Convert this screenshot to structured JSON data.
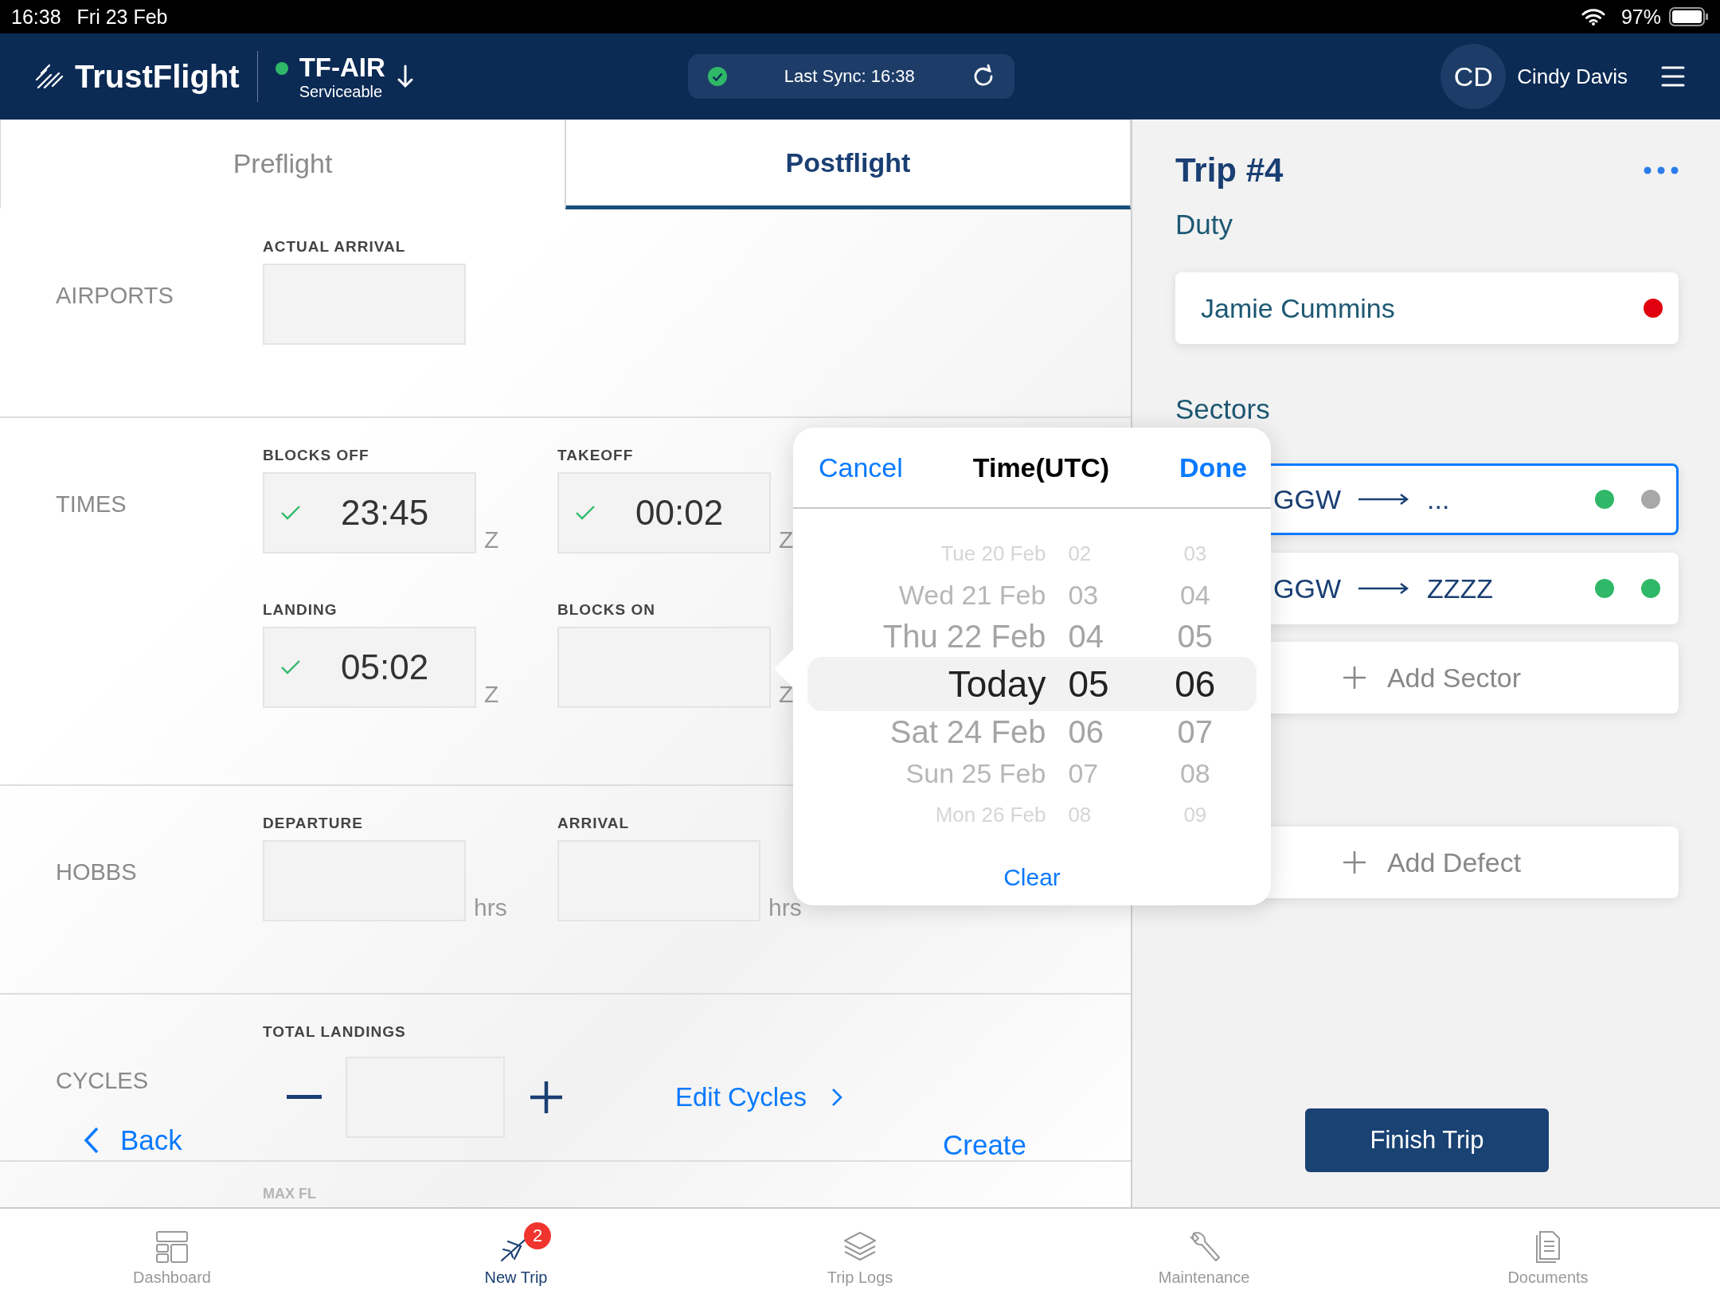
{
  "status_bar": {
    "time": "16:38",
    "date": "Fri 23 Feb",
    "battery": "97%"
  },
  "header": {
    "brand": "TrustFlight",
    "aircraft": "TF-AIR",
    "aircraft_status": "Serviceable",
    "sync": "Last Sync: 16:38",
    "avatar": "CD",
    "user": "Cindy Davis"
  },
  "tabs": [
    {
      "label": "Preflight",
      "selected": false
    },
    {
      "label": "Postflight",
      "selected": true
    }
  ],
  "sections": [
    {
      "title": "AIRPORTS",
      "rows": [
        [
          {
            "label": "ACTUAL ARRIVAL",
            "checked": false
          }
        ]
      ]
    },
    {
      "title": "TIMES",
      "rows": [
        [
          {
            "label": "BLOCKS OFF",
            "value": "23:45",
            "checked": true,
            "unit": "Z"
          },
          {
            "label": "TAKEOFF",
            "value": "00:02",
            "checked": true,
            "unit": "Z"
          }
        ],
        [
          {
            "label": "LANDING",
            "value": "05:02",
            "checked": true,
            "unit": "Z"
          },
          {
            "label": "BLOCKS ON",
            "checked": false,
            "unit": "Z"
          }
        ]
      ]
    },
    {
      "title": "HOBBS",
      "rows": [
        [
          {
            "label": "DEPARTURE",
            "checked": false,
            "unit": "hrs"
          },
          {
            "label": "ARRIVAL",
            "checked": false,
            "unit": "hrs"
          }
        ]
      ]
    }
  ],
  "cycles": {
    "title": "CYCLES",
    "label": "TOTAL LANDINGS",
    "link": "Edit Cycles"
  },
  "next_label": "MAX FL",
  "back": "Back",
  "create": "Create",
  "picker": {
    "cancel": "Cancel",
    "title": "Time(UTC)",
    "done": "Done",
    "clear": "Clear",
    "rows": [
      {
        "date": "Tue 20 Feb",
        "hour": "02",
        "minute": "03",
        "selected": false
      },
      {
        "date": "Wed 21 Feb",
        "hour": "03",
        "minute": "04",
        "selected": false
      },
      {
        "date": "Thu 22 Feb",
        "hour": "04",
        "minute": "05",
        "selected": false
      },
      {
        "date": "Today",
        "hour": "05",
        "minute": "06",
        "selected": true
      },
      {
        "date": "Sat 24 Feb",
        "hour": "06",
        "minute": "07",
        "selected": false
      },
      {
        "date": "Sun 25 Feb",
        "hour": "07",
        "minute": "08",
        "selected": false
      },
      {
        "date": "Mon 26 Feb",
        "hour": "08",
        "minute": "09",
        "selected": false
      }
    ]
  },
  "trip": {
    "title": "Trip #4",
    "duty_heading": "Duty",
    "crew": {
      "name": "Jamie Cummins",
      "color": "#e0000f"
    },
    "sectors_heading": "Sectors",
    "sectors": [
      {
        "from": "GGW",
        "to": "...",
        "selected": true,
        "dots": [
          {
            "color": "#2fb867"
          },
          {
            "color": "#a8a8a8"
          }
        ]
      },
      {
        "from": "GGW",
        "to": "ZZZZ",
        "selected": false,
        "dots": [
          {
            "color": "#2fb867"
          },
          {
            "color": "#2fb867"
          }
        ]
      }
    ],
    "add_sector": "Add Sector",
    "add_defect": "Add Defect",
    "finish": "Finish Trip"
  },
  "bottom_tabs": [
    {
      "label": "Dashboard",
      "selected": false
    },
    {
      "label": "New Trip",
      "selected": true,
      "badge": "2"
    },
    {
      "label": "Trip Logs",
      "selected": false
    },
    {
      "label": "Maintenance",
      "selected": false
    },
    {
      "label": "Documents",
      "selected": false
    }
  ]
}
